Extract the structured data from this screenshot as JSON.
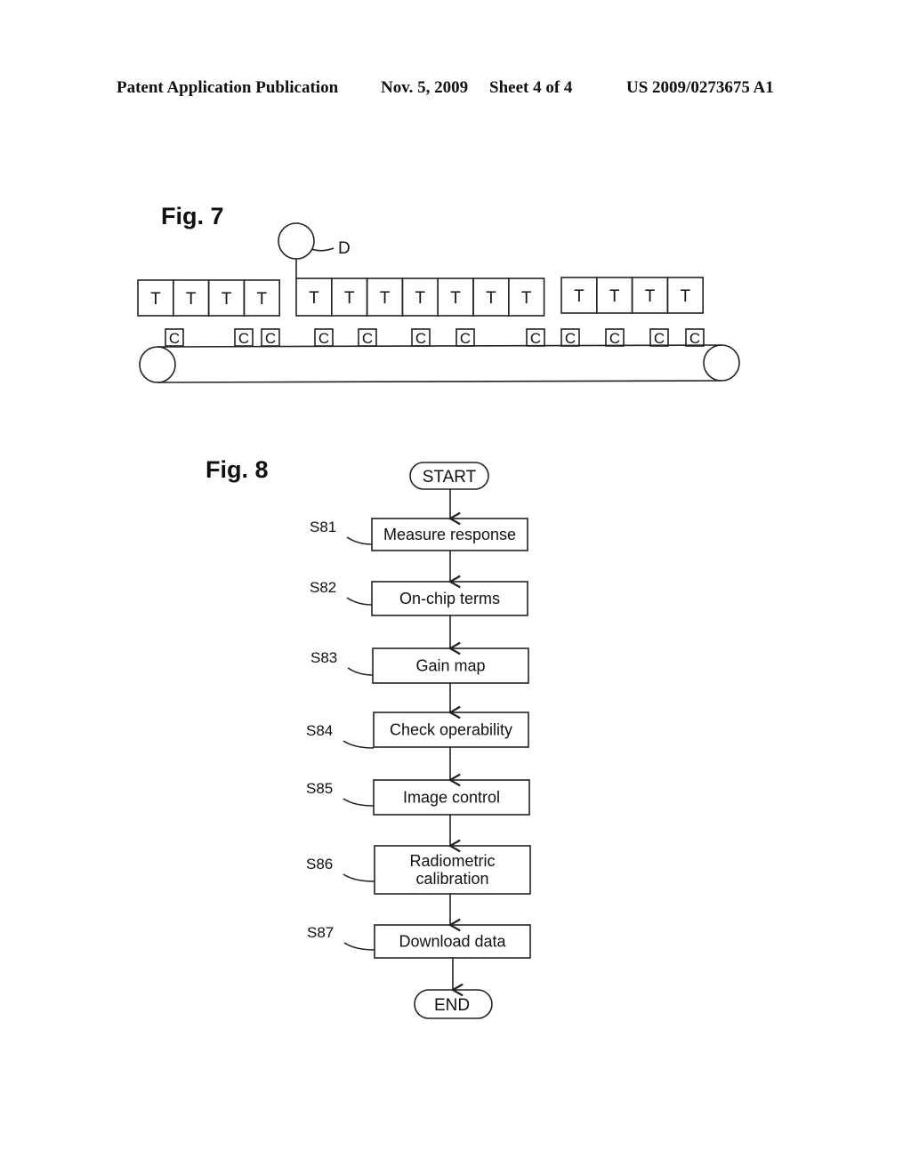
{
  "header": {
    "publication": "Patent Application Publication",
    "date": "Nov. 5, 2009",
    "sheet": "Sheet 4 of 4",
    "number": "US 2009/0273675 A1"
  },
  "fig7": {
    "title": "Fig. 7",
    "detector_label": "D",
    "groups": [
      {
        "cells": [
          "T",
          "T",
          "T",
          "T"
        ]
      },
      {
        "cells": [
          "T",
          "T",
          "T",
          "T",
          "T",
          "T",
          "T"
        ]
      },
      {
        "cells": [
          "T",
          "T",
          "T",
          "T"
        ]
      }
    ],
    "carrier_label": "C",
    "carrier_count": 12
  },
  "fig8": {
    "title": "Fig. 8",
    "start": "START",
    "end": "END",
    "steps": [
      {
        "id": "S81",
        "lines": [
          "Measure response"
        ]
      },
      {
        "id": "S82",
        "lines": [
          "On-chip terms"
        ]
      },
      {
        "id": "S83",
        "lines": [
          "Gain map"
        ]
      },
      {
        "id": "S84",
        "lines": [
          "Check operability"
        ]
      },
      {
        "id": "S85",
        "lines": [
          "Image control"
        ]
      },
      {
        "id": "S86",
        "lines": [
          "Radiometric",
          "calibration"
        ]
      },
      {
        "id": "S87",
        "lines": [
          "Download data"
        ]
      }
    ]
  }
}
